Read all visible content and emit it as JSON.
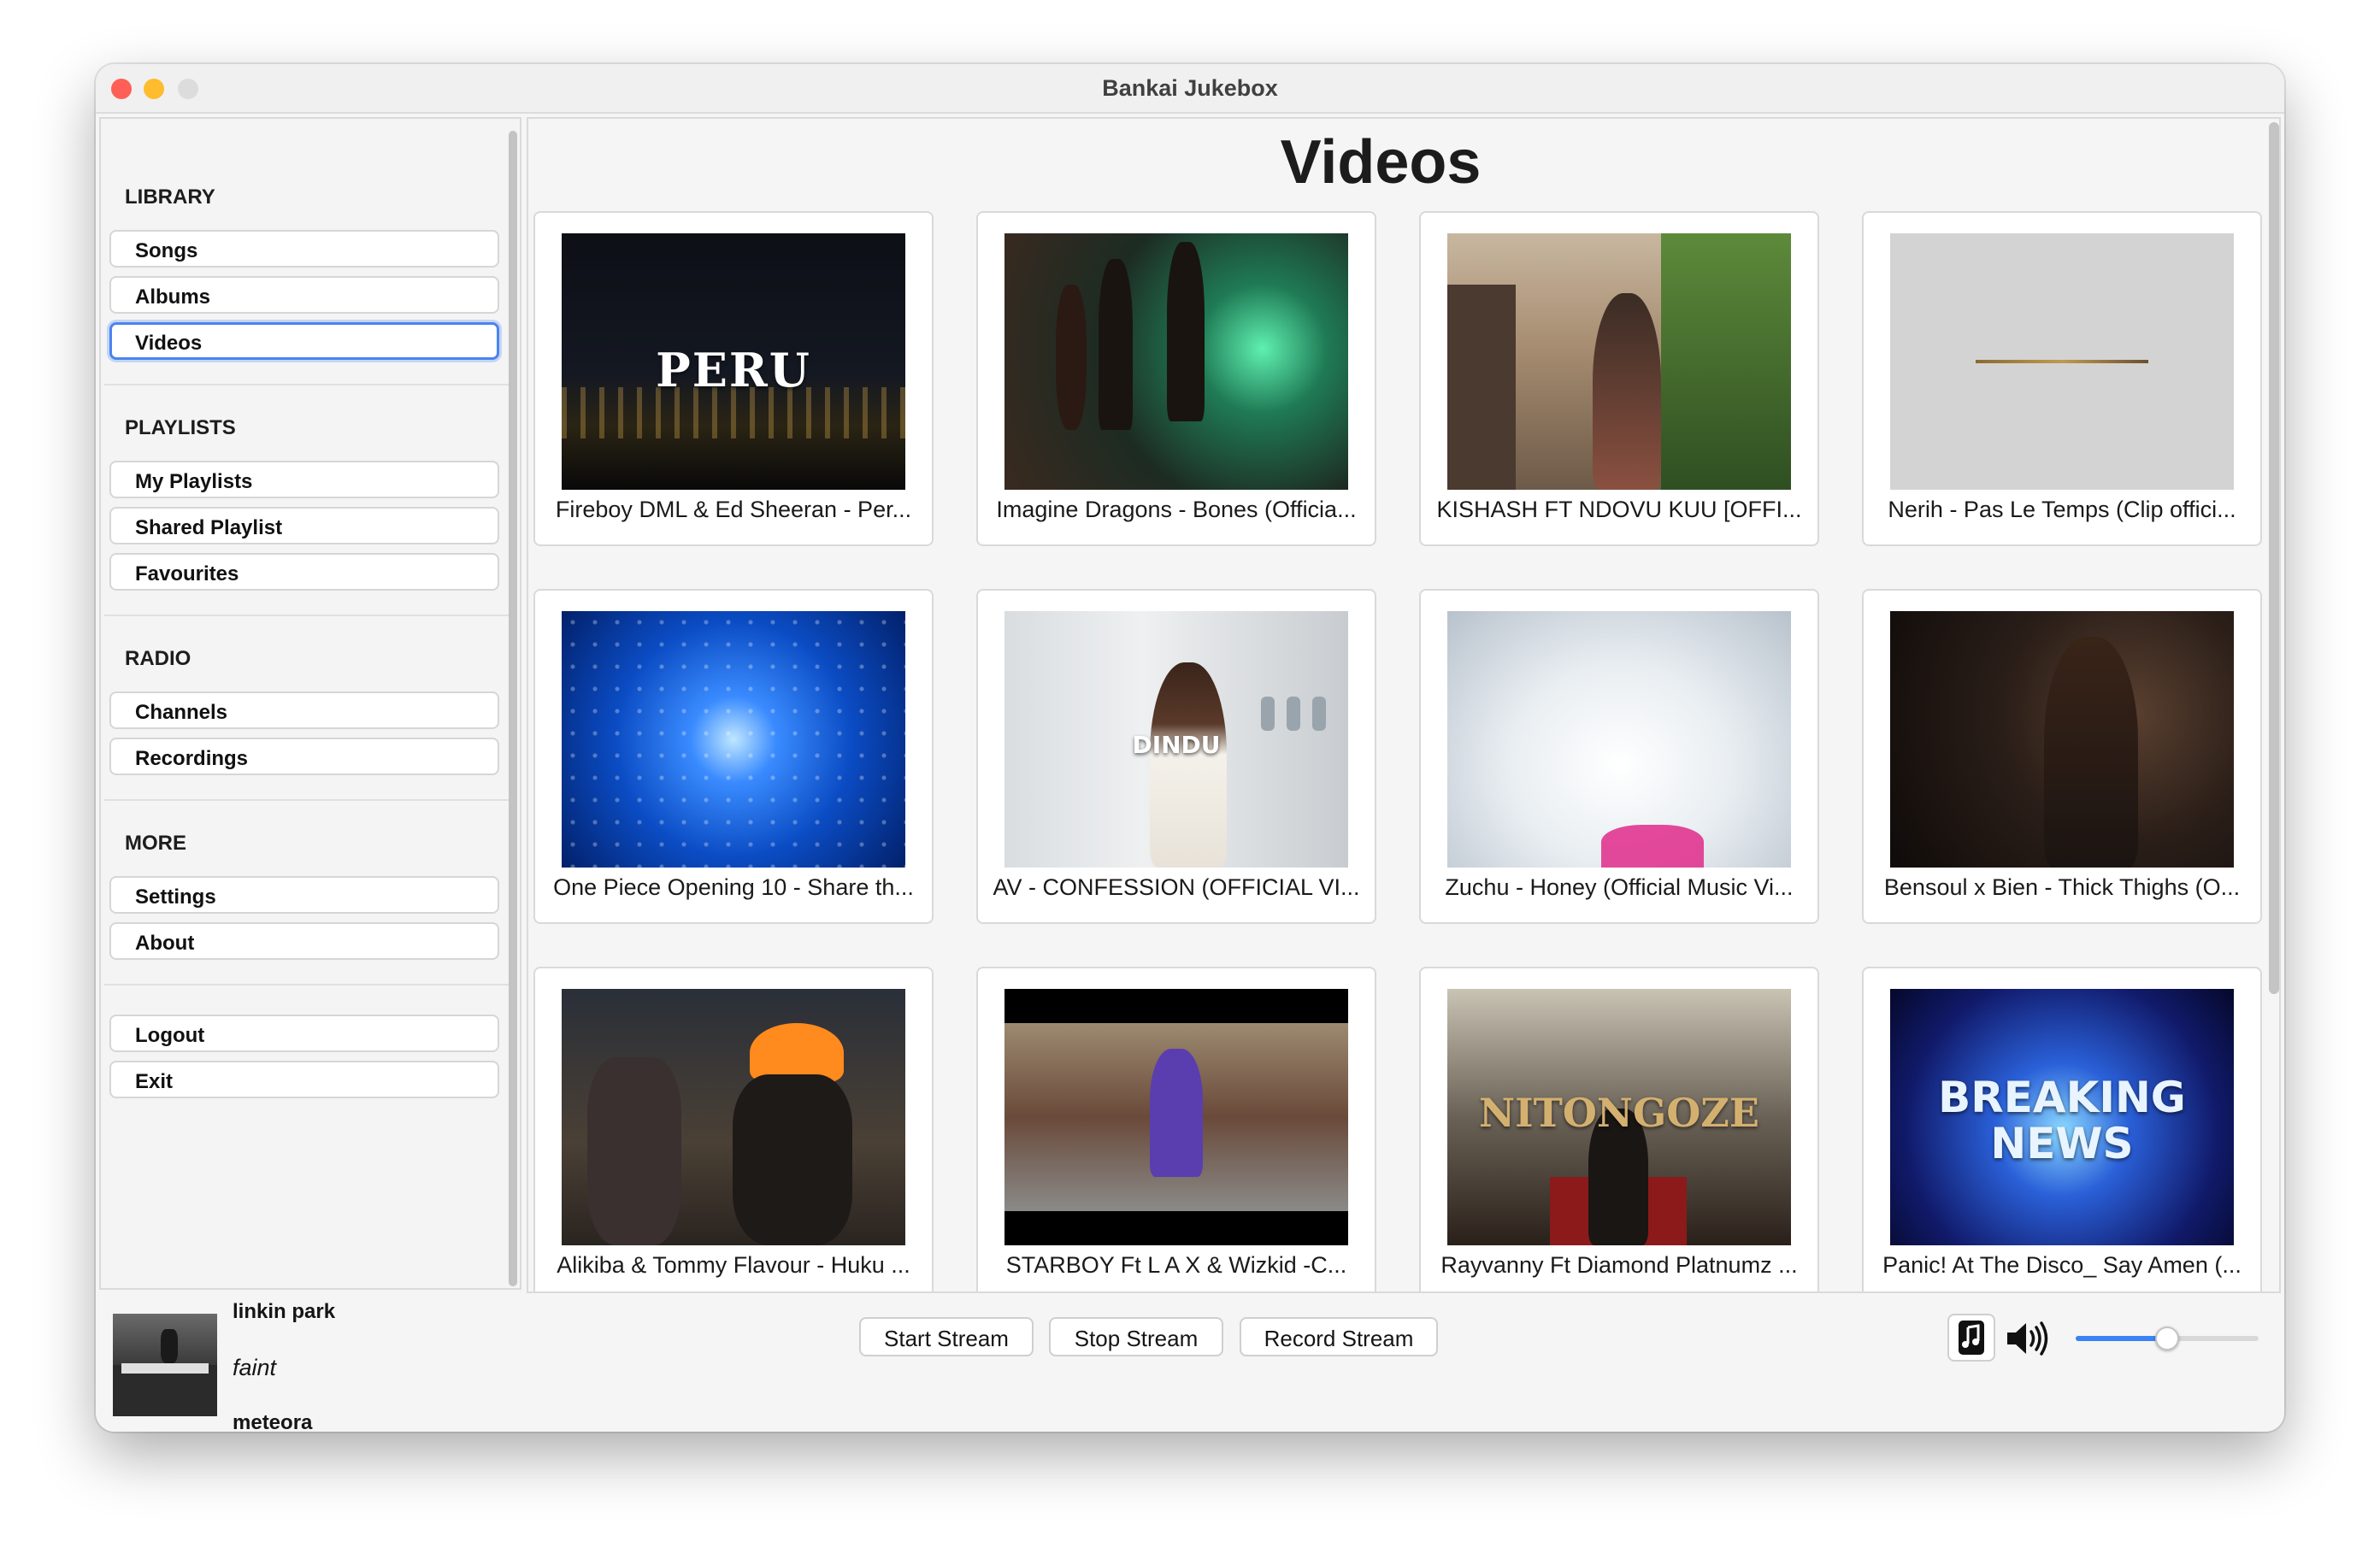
{
  "window": {
    "title": "Bankai Jukebox"
  },
  "sidebar": {
    "library": {
      "heading": "LIBRARY",
      "items": [
        "Songs",
        "Albums",
        "Videos"
      ]
    },
    "playlists": {
      "heading": "PLAYLISTS",
      "items": [
        "My Playlists",
        "Shared Playlist",
        "Favourites"
      ]
    },
    "radio": {
      "heading": "RADIO",
      "items": [
        "Channels",
        "Recordings"
      ]
    },
    "more": {
      "heading": "MORE",
      "items": [
        "Settings",
        "About"
      ]
    },
    "account": {
      "items": [
        "Logout",
        "Exit"
      ]
    },
    "selected": "Videos"
  },
  "main": {
    "title": "Videos",
    "videos": [
      {
        "title": "Fireboy DML & Ed Sheeran - Per...",
        "thumb_text": "PERU"
      },
      {
        "title": "Imagine Dragons - Bones (Officia..."
      },
      {
        "title": "KISHASH FT NDOVU KUU [OFFI..."
      },
      {
        "title": "Nerih - Pas Le Temps (Clip offici..."
      },
      {
        "title": "One Piece Opening 10 - Share th..."
      },
      {
        "title": "AV - CONFESSION (OFFICIAL VI...",
        "thumb_text": "DINDU"
      },
      {
        "title": "Zuchu - Honey (Official Music Vi..."
      },
      {
        "title": "Bensoul x Bien - Thick Thighs (O..."
      },
      {
        "title": "Alikiba & Tommy Flavour - Huku ..."
      },
      {
        "title": "STARBOY Ft  L A X & Wizkid -C..."
      },
      {
        "title": "Rayvanny Ft Diamond Platnumz ...",
        "thumb_text": "NITONGOZE"
      },
      {
        "title": "Panic! At The Disco_ Say Amen (...",
        "thumb_text": "BREAKING NEWS"
      }
    ]
  },
  "player": {
    "artist": "linkin park",
    "song": "faint",
    "album": "meteora",
    "buttons": [
      "Start Stream",
      "Stop Stream",
      "Record Stream"
    ],
    "volume": 0.5,
    "icons": {
      "music": "music-note-icon",
      "volume": "speaker-volume-icon"
    }
  },
  "colors": {
    "accent": "#4a84f0",
    "slider": "#3b82f6"
  }
}
